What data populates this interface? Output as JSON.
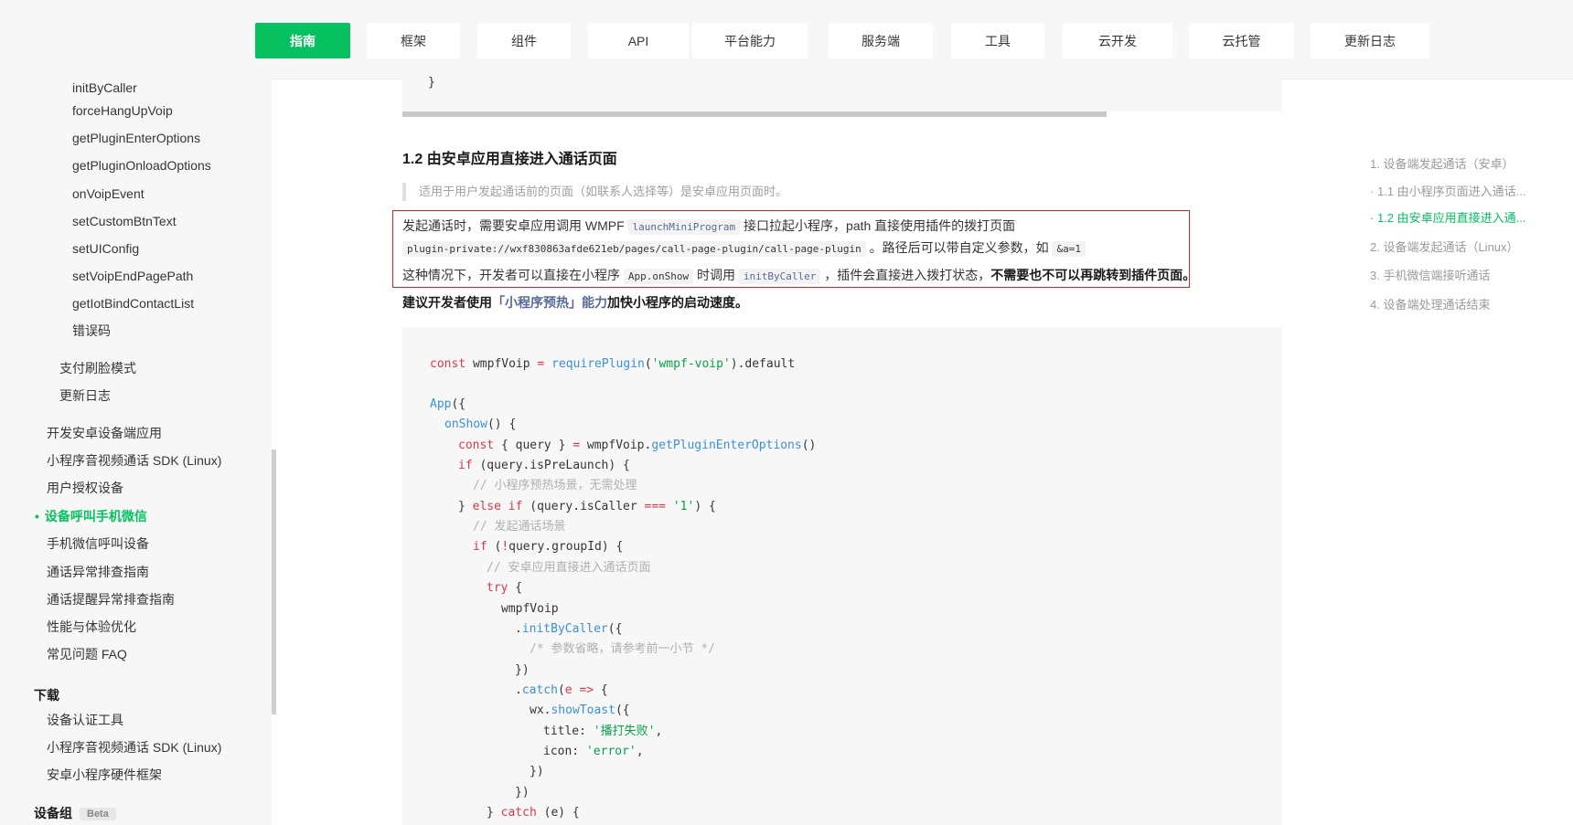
{
  "nav": {
    "tabs": [
      "指南",
      "框架",
      "组件",
      "API",
      "平台能力",
      "服务端",
      "工具",
      "云开发",
      "云托管",
      "更新日志"
    ],
    "active_index": 0
  },
  "sidebar": {
    "api_items": [
      "initByCaller",
      "forceHangUpVoip",
      "getPluginEnterOptions",
      "getPluginOnloadOptions",
      "onVoipEvent",
      "setCustomBtnText",
      "setUIConfig",
      "setVoipEndPagePath",
      "getIotBindContactList",
      "错误码"
    ],
    "sub_items": [
      "支付刷脸模式",
      "更新日志"
    ],
    "guide_items": [
      "开发安卓设备端应用",
      "小程序音视频通话 SDK (Linux)",
      "用户授权设备",
      "设备呼叫手机微信",
      "手机微信呼叫设备",
      "通话异常排查指南",
      "通话提醒异常排查指南",
      "性能与体验优化",
      "常见问题 FAQ"
    ],
    "active_item": "设备呼叫手机微信",
    "download_heading": "下载",
    "download_items": [
      "设备认证工具",
      "小程序音视频通话 SDK (Linux)",
      "安卓小程序硬件框架"
    ],
    "group_heading": "设备组",
    "group_badge": "Beta"
  },
  "content": {
    "section_title": "1.2 由安卓应用直接进入通话页面",
    "quote": "适用于用户发起通话前的页面（如联系人选择等）是安卓应用页面时。",
    "line1_a": "发起通话时，需要安卓应用调用 WMPF",
    "line1_code": "launchMiniProgram",
    "line1_b": "接口拉起小程序，path 直接使用插件的拨打页面",
    "line2_code": "plugin-private://wxf830863afde621eb/pages/call-page-plugin/call-page-plugin",
    "line2_b": "。路径后可以带自定义参数，如",
    "line2_code2": "&a=1",
    "line3_a": "这种情况下，开发者可以直接在小程序",
    "line3_code": "App.onShow",
    "line3_b": "时调用",
    "line3_code2": "initByCaller",
    "line3_c": "，插件会直接进入拨打状态，",
    "line3_strong": "不需要也不可以再跳转到插件页面。",
    "line4_a": "建议开发者使用",
    "line4_link": "「小程序预热」能力",
    "line4_b": "加快小程序的启动速度。"
  },
  "code": {
    "l1_kw": "const",
    "l1_a": " wmpfVoip ",
    "l1_op": "=",
    "l1_fn": " requirePlugin",
    "l1_p": "(",
    "l1_str": "'wmpf-voip'",
    "l1_b": ").default",
    "l2_fn": "App",
    "l2_b": "({",
    "l3_fn": "onShow",
    "l3_b": "() {",
    "l4_kw": "const",
    "l4_a": " { query } ",
    "l4_op": "=",
    "l4_b": " wmpfVoip.",
    "l4_fn": "getPluginEnterOptions",
    "l4_c": "()",
    "l5_kw": "if",
    "l5_b": " (query.isPreLaunch) {",
    "l6_cm": "// 小程序预热场景，无需处理",
    "l7_a": "} ",
    "l7_kw": "else if",
    "l7_b": " (query.isCaller ",
    "l7_op": "===",
    "l7_str": " '1'",
    "l7_c": ") {",
    "l8_cm": "// 发起通话场景",
    "l9_kw": "if",
    "l9_b": " (",
    "l9_op": "!",
    "l9_c": "query.groupId) {",
    "l10_cm": "// 安卓应用直接进入通话页面",
    "l11_kw": "try",
    "l11_b": " {",
    "l12_a": "wmpfVoip",
    "l13_a": ".",
    "l13_fn": "initByCaller",
    "l13_b": "({",
    "l14_cm": "/* 参数省略，请参考前一小节 */",
    "l15_a": "})",
    "l16_a": ".",
    "l16_fn": "catch",
    "l16_b": "(",
    "l16_kw": "e",
    "l16_op": " =>",
    "l16_c": " {",
    "l17_a": "wx.",
    "l17_fn": "showToast",
    "l17_b": "({",
    "l18_a": "title: ",
    "l18_str": "'播打失败'",
    "l18_b": ",",
    "l19_a": "icon: ",
    "l19_str": "'error'",
    "l19_b": ",",
    "l20_a": "})",
    "l21_a": "})",
    "l22_a": "} ",
    "l22_kw": "catch",
    "l22_b": " (e) {"
  },
  "toc": {
    "items": [
      "1. 设备端发起通话（安卓）",
      "· 1.1 由小程序页面进入通话...",
      "· 1.2 由安卓应用直接进入通...",
      "2. 设备端发起通话（Linux）",
      "3. 手机微信端接听通话",
      "4. 设备端处理通话结束"
    ],
    "active_index": 2
  },
  "colors": {
    "brand": "#07c160",
    "link": "#576b95",
    "highlight_border": "#e02020"
  }
}
